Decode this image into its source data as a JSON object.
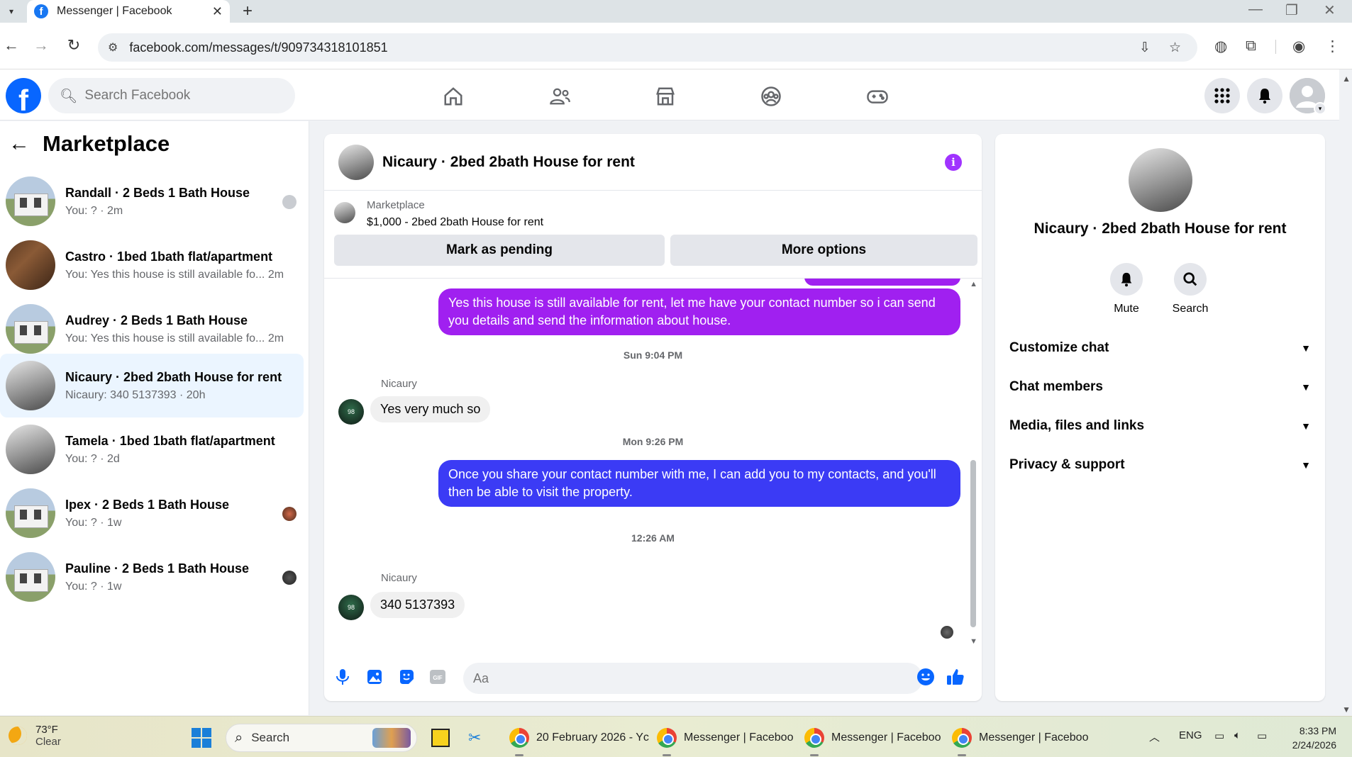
{
  "browser": {
    "tab_title": "Messenger | Facebook",
    "url": "facebook.com/messages/t/909734318101851"
  },
  "fb": {
    "search_placeholder": "Search Facebook"
  },
  "sidebar": {
    "title": "Marketplace",
    "conversations": [
      {
        "name": "Randall · 2 Beds 1 Bath House",
        "preview": "You: ? · 2m"
      },
      {
        "name": "Castro · 1bed 1bath flat/apartment",
        "preview": "You: Yes this house is still available fo...  2m"
      },
      {
        "name": "Audrey · 2 Beds 1 Bath House",
        "preview": "You: Yes this house is still available fo...  2m"
      },
      {
        "name": "Nicaury · 2bed 2bath House for rent",
        "preview": "Nicaury: 340 5137393 · 20h"
      },
      {
        "name": "Tamela · 1bed 1bath flat/apartment",
        "preview": "You: ? · 2d"
      },
      {
        "name": "Ipex · 2 Beds 1 Bath House",
        "preview": "You: ? · 1w"
      },
      {
        "name": "Pauline · 2 Beds 1 Bath House",
        "preview": "You: ? · 1w"
      }
    ]
  },
  "chat": {
    "title": "Nicaury · 2bed 2bath House for rent",
    "listing": {
      "label": "Marketplace",
      "price_title": "$1,000 - 2bed 2bath House for rent",
      "mark_pending": "Mark as pending",
      "more_options": "More options"
    },
    "messages": {
      "out1": "Yes this house is still available for rent, let me have your contact number so i can send you details and send the information about house.",
      "ts1": "Sun 9:04 PM",
      "sender1": "Nicaury",
      "in1": "Yes very much so",
      "ts2": "Mon 9:26 PM",
      "out2": "Once you share your contact number with me, I can add you to my contacts, and you'll then be able to visit the property.",
      "ts3": "12:26 AM",
      "sender2": "Nicaury",
      "in2": "340 5137393"
    },
    "composer_placeholder": "Aa"
  },
  "info": {
    "name": "Nicaury · 2bed 2bath House for rent",
    "mute": "Mute",
    "search": "Search",
    "sections": [
      "Customize chat",
      "Chat members",
      "Media, files and links",
      "Privacy & support"
    ]
  },
  "taskbar": {
    "temp": "73°F",
    "condition": "Clear",
    "search": "Search",
    "apps": [
      "20 February 2026 - Yc",
      "Messenger | Faceboo",
      "Messenger | Faceboo",
      "Messenger | Faceboo"
    ],
    "lang": "ENG",
    "time": "8:33 PM",
    "date": "2/24/2026"
  },
  "colors": {
    "fb_blue": "#0866ff",
    "bubble_purple": "#a020f0",
    "bubble_blue": "#3b3bf5",
    "active_row": "#ebf5ff"
  }
}
